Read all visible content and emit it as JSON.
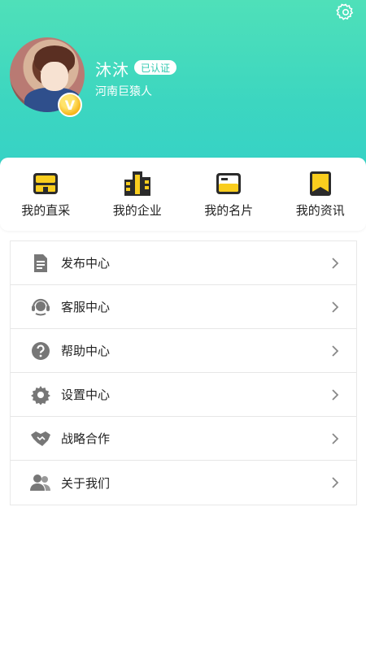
{
  "profile": {
    "name": "沐沐",
    "verified_label": "已认证",
    "location": "河南巨猿人",
    "vip_letter": "V"
  },
  "quick_actions": [
    {
      "label": "我的直采",
      "icon": "store-icon"
    },
    {
      "label": "我的企业",
      "icon": "building-icon"
    },
    {
      "label": "我的名片",
      "icon": "card-icon"
    },
    {
      "label": "我的资讯",
      "icon": "bookmark-icon"
    }
  ],
  "menu": [
    {
      "label": "发布中心",
      "icon": "document-icon"
    },
    {
      "label": "客服中心",
      "icon": "headset-icon"
    },
    {
      "label": "帮助中心",
      "icon": "question-icon"
    },
    {
      "label": "设置中心",
      "icon": "gear-icon"
    },
    {
      "label": "战略合作",
      "icon": "handshake-icon"
    },
    {
      "label": "关于我们",
      "icon": "users-icon"
    }
  ],
  "colors": {
    "header_gradient_top": "#4fe0b9",
    "header_gradient_bottom": "#36d2c6",
    "quick_icon_yellow": "#f9cd1e",
    "menu_icon_gray": "#777777"
  }
}
